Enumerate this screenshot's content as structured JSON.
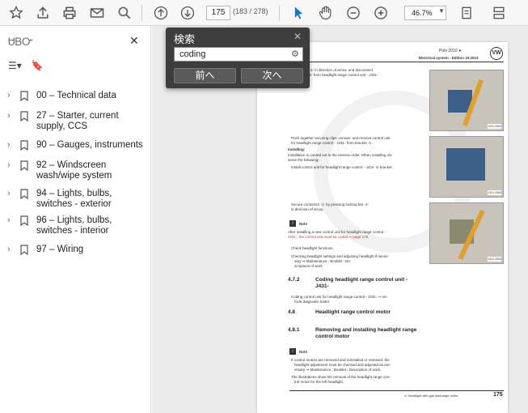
{
  "toolbar": {
    "page_current": "175",
    "page_total": "(183 / 278)",
    "zoom": "46.7%"
  },
  "sidebar": {
    "title": "ᏌᏴᏅ",
    "items": [
      {
        "label": "00 – Technical data"
      },
      {
        "label": "27 – Starter, current supply, CCS"
      },
      {
        "label": "90 – Gauges, instruments"
      },
      {
        "label": "92 – Windscreen wash/wipe system"
      },
      {
        "label": "94 – Lights, bulbs, switches - exterior"
      },
      {
        "label": "96 – Lights, bulbs, switches - interior"
      },
      {
        "label": "97 – Wiring"
      }
    ]
  },
  "search": {
    "title": "検索",
    "value": "coding",
    "prev_label": "前へ",
    "next_label": "次へ"
  },
  "document": {
    "header_right": "Polo 2010 ➤",
    "header_sub": "Electrical system - Edition 10.2013",
    "lines": [
      "locking lug -2- in direction of arrow, and disconnect",
      "connector -2- from headlight range control unit - J431-.",
      "Push together securing clips -arrows- and remove control unit",
      "for headlight range control - J431- from bracket -1-.",
      "Installing:",
      "Installation is carried out in the reverse order. When installing ob-",
      "serve the following:",
      "Install control unit for headlight range control - J431- in bracket.",
      "Secure connector -1- by pressing locking bar -2-",
      "in direction of arrow.",
      "Note",
      "After installing a new control unit for headlight range control -",
      "J431-, the control unit must be coded ⇒ page 175.",
      "Check headlight functions.",
      "Checking headlight settings and adjusting headlight if neces-",
      "sary ⇒ Maintenance ; Booklet ; De-",
      "scriptions of work"
    ],
    "sec1_num": "4.7.2",
    "sec1_title": "Coding headlight range control unit - J431-",
    "sec1_text": "Coding control unit for headlight range control - J431- ⇒ Ve-",
    "sec1_text2": "hicle diagnostic tester.",
    "sec2_num": "4.8",
    "sec2_title": "Headlight range control motor",
    "sec3_num": "4.8.1",
    "sec3_title": "Removing and installing headlight range control motor",
    "note2": "Note",
    "note_lines": [
      "If control motors are removed and reinstalled or renewed, the",
      "headlight adjustment must be checked and adjusted as nec-",
      "essary ⇒ Maintenance ; Booklet ; Description of work.",
      "The illustrations show the removal of the headlight range con-",
      "trol motor for the left headlight."
    ],
    "footer": "4. Headlight with gas discharge bulbs",
    "page_number": "175",
    "fig_labels": [
      "J431-2062",
      "J431-2063",
      "J431-2064"
    ]
  }
}
